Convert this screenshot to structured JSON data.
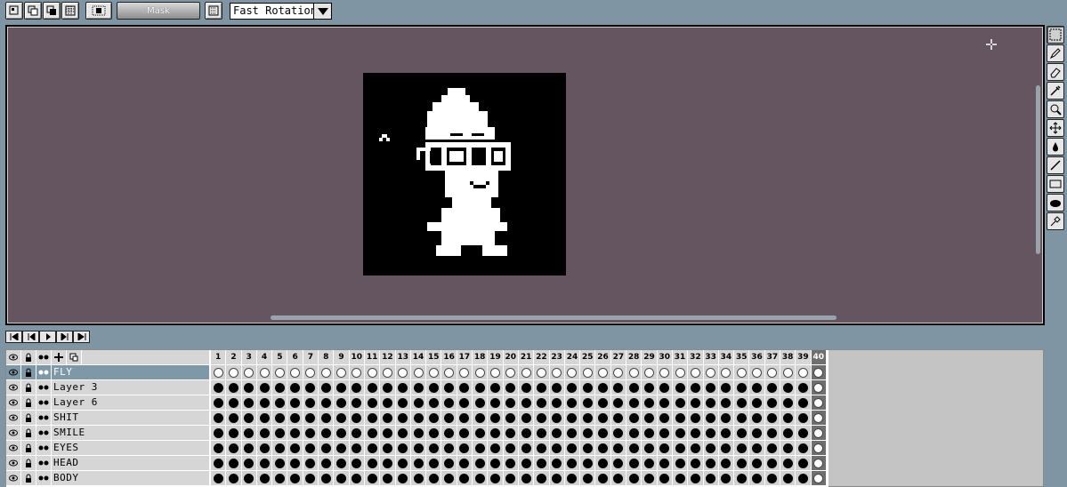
{
  "toolbar": {
    "mask_label": "Mask",
    "rotation_mode": "Fast Rotation"
  },
  "tools": [
    "marquee-select",
    "pencil",
    "eraser",
    "eyedropper",
    "zoom",
    "move",
    "fill-drop",
    "line",
    "rectangle",
    "brush",
    "smudge"
  ],
  "frames": [
    "1",
    "2",
    "3",
    "4",
    "5",
    "6",
    "7",
    "8",
    "9",
    "10",
    "11",
    "12",
    "13",
    "14",
    "15",
    "16",
    "17",
    "18",
    "19",
    "20",
    "21",
    "22",
    "23",
    "24",
    "25",
    "26",
    "27",
    "28",
    "29",
    "30",
    "31",
    "32",
    "33",
    "34",
    "35",
    "36",
    "37",
    "38",
    "39",
    "40"
  ],
  "layers": [
    {
      "name": "FLY",
      "selected": true
    },
    {
      "name": "Layer 3",
      "selected": false
    },
    {
      "name": "Layer 6",
      "selected": false
    },
    {
      "name": "SHIT",
      "selected": false
    },
    {
      "name": "SMILE",
      "selected": false
    },
    {
      "name": "EYES",
      "selected": false
    },
    {
      "name": "HEAD",
      "selected": false
    },
    {
      "name": "BODY",
      "selected": false
    }
  ],
  "colors": {
    "canvas_bg": "#655560",
    "selection": "#7f98a8",
    "app_bg": "#8095a4"
  }
}
